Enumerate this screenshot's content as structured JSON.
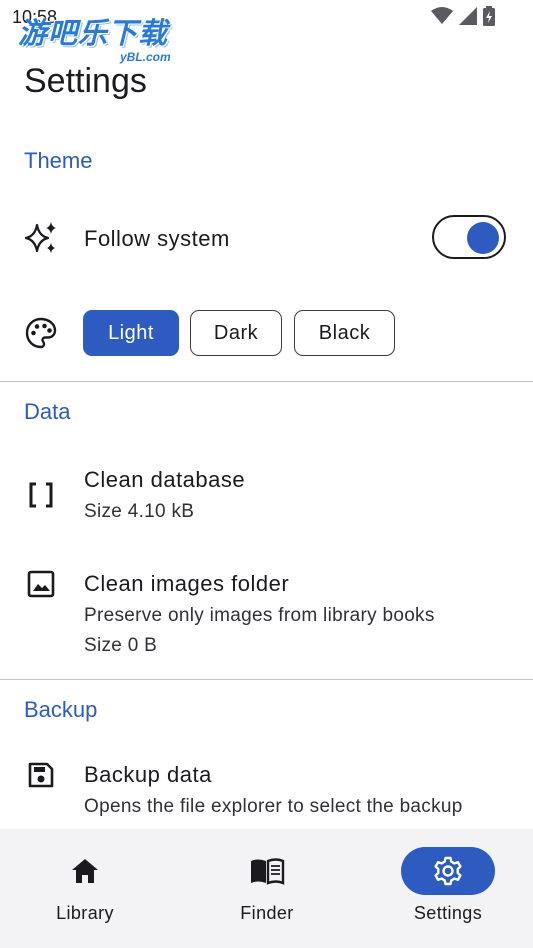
{
  "status_bar": {
    "time": "10:58",
    "icons": [
      "wifi-icon",
      "signal-icon",
      "battery-charging-icon"
    ]
  },
  "watermark": {
    "text": "游吧乐下载",
    "sub": "yBL.com"
  },
  "page_title": "Settings",
  "theme": {
    "header": "Theme",
    "follow_system": {
      "label": "Follow system",
      "enabled": true,
      "icon": "sparkles-icon"
    },
    "palette_icon": "palette-icon",
    "options": [
      "Light",
      "Dark",
      "Black"
    ],
    "selected": "Light"
  },
  "data": {
    "header": "Data",
    "items": [
      {
        "title": "Clean database",
        "subtitle": "Size 4.10 kB",
        "icon": "brackets-icon"
      },
      {
        "title": "Clean images folder",
        "subtitle": "Preserve only images from library books",
        "subtitle2": "Size 0 B",
        "icon": "image-icon"
      }
    ]
  },
  "backup": {
    "header": "Backup",
    "items": [
      {
        "title": "Backup data",
        "subtitle": "Opens the file explorer to select the backup",
        "icon": "save-icon"
      }
    ]
  },
  "bottom_nav": {
    "items": [
      {
        "label": "Library",
        "icon": "home-icon",
        "active": false
      },
      {
        "label": "Finder",
        "icon": "book-open-icon",
        "active": false
      },
      {
        "label": "Settings",
        "icon": "gear-icon",
        "active": true
      }
    ]
  },
  "colors": {
    "accent": "#2d5bbf",
    "nav_background": "#f3f3f5",
    "divider": "#c4c6cf"
  }
}
